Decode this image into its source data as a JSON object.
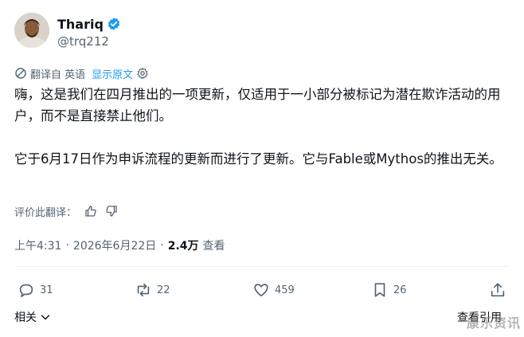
{
  "author": {
    "display_name": "Thariq",
    "handle": "@trq212",
    "verified_icon": "verified-badge-icon"
  },
  "translation": {
    "label": "翻译自 英语",
    "show_original": "显示原文"
  },
  "tweet": {
    "text": "嗨，这是我们在四月推出的一项更新，仅适用于一小部分被标记为潜在欺诈活动的用户，而不是直接禁止他们。\n\n它于6月17日作为申诉流程的更新而进行了更新。它与Fable或Mythos的推出无关。"
  },
  "rate_translation": {
    "label": "评价此翻译："
  },
  "meta": {
    "time": "上午4:31",
    "date": "2026年6月22日",
    "views_count": "2.4万",
    "views_label": "查看"
  },
  "actions": {
    "replies": "31",
    "reposts": "22",
    "likes": "459",
    "bookmarks": "26"
  },
  "footer": {
    "related_label": "相关",
    "see_quotes_label": "查看引用"
  },
  "watermark": "康乐资讯",
  "colors": {
    "accent": "#1d9bf0",
    "text": "#0f1419",
    "secondary": "#536471"
  }
}
